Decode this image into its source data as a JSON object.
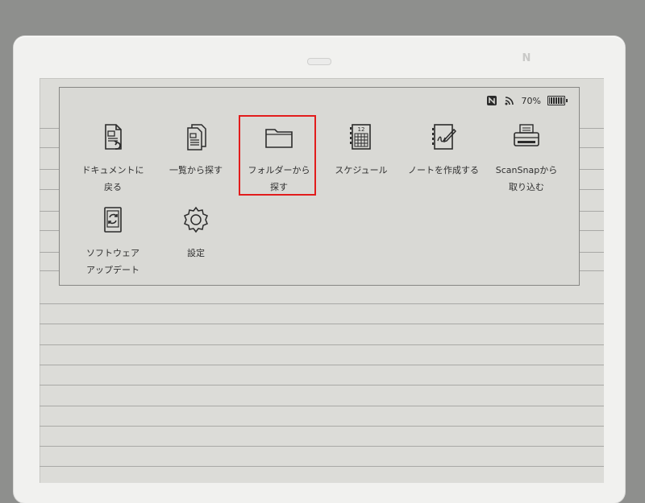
{
  "status": {
    "battery_percent": "70%",
    "icons": [
      "nfc-icon",
      "wifi-icon",
      "battery-icon"
    ]
  },
  "device": {
    "nfc_logo": "N"
  },
  "menu": {
    "items": [
      {
        "id": "back-to-document",
        "label": "ドキュメントに\n戻る",
        "icon": "document-back-icon"
      },
      {
        "id": "search-from-list",
        "label": "一覧から探す",
        "icon": "documents-list-icon"
      },
      {
        "id": "search-from-folder",
        "label": "フォルダーから\n探す",
        "icon": "folder-icon",
        "highlighted": true
      },
      {
        "id": "schedule",
        "label": "スケジュール",
        "icon": "calendar-icon",
        "calendar_day": "12"
      },
      {
        "id": "create-note",
        "label": "ノートを作成する",
        "icon": "note-pen-icon"
      },
      {
        "id": "scansnap-import",
        "label": "ScanSnapから\n取り込む",
        "icon": "scanner-icon"
      },
      {
        "id": "software-update",
        "label": "ソフトウェア\nアップデート",
        "icon": "update-icon"
      },
      {
        "id": "settings",
        "label": "設定",
        "icon": "gear-icon"
      }
    ]
  },
  "colors": {
    "screen": "#dcdcd8",
    "highlight": "#e21c1c",
    "bezel": "#f1f1ef"
  }
}
